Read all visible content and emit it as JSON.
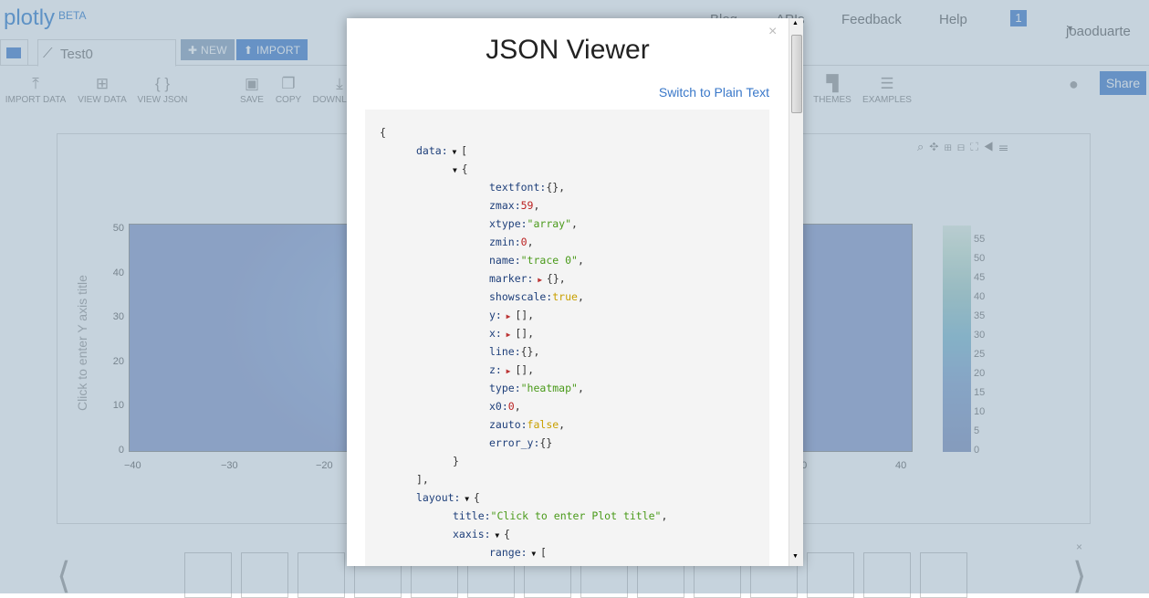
{
  "header": {
    "logo": "plotly",
    "logo_badge": "BETA",
    "nav": [
      "Blog",
      "APIs",
      "Feedback",
      "Help"
    ],
    "notification_count": "1",
    "user": "joaoduarte"
  },
  "tabs": {
    "active": "Test0",
    "new_label": "NEW",
    "import_label": "IMPORT"
  },
  "toolbar": {
    "items": [
      "IMPORT DATA",
      "VIEW DATA",
      "VIEW JSON",
      "SAVE",
      "COPY",
      "DOWNLOAD",
      "THEMES",
      "EXAMPLES"
    ],
    "share": "Share"
  },
  "plot": {
    "ytitle": "Click to enter Y axis title",
    "xticks": [
      "−40",
      "−30",
      "−20",
      "30",
      "40"
    ],
    "yticks": [
      "0",
      "10",
      "20",
      "30",
      "40",
      "50"
    ],
    "colorbar_ticks": [
      "0",
      "5",
      "10",
      "15",
      "20",
      "25",
      "30",
      "35",
      "40",
      "45",
      "50",
      "55"
    ]
  },
  "modal": {
    "title": "JSON Viewer",
    "switch_link": "Switch to Plain Text",
    "close": "×",
    "lines": [
      {
        "i": 0,
        "seg": [
          [
            "p",
            "{"
          ]
        ]
      },
      {
        "i": 1,
        "seg": [
          [
            "k",
            "data:"
          ],
          [
            "td",
            " ▼ "
          ],
          [
            "p",
            "["
          ]
        ]
      },
      {
        "i": 2,
        "seg": [
          [
            "td",
            "▼ "
          ],
          [
            "p",
            "{"
          ]
        ]
      },
      {
        "i": 3,
        "seg": [
          [
            "k",
            "textfont:"
          ],
          [
            "p",
            "{},"
          ]
        ]
      },
      {
        "i": 3,
        "seg": [
          [
            "k",
            "zmax:"
          ],
          [
            "n",
            "59"
          ],
          [
            "p",
            ","
          ]
        ]
      },
      {
        "i": 3,
        "seg": [
          [
            "k",
            "xtype:"
          ],
          [
            "s",
            "\"array\""
          ],
          [
            "p",
            ","
          ]
        ]
      },
      {
        "i": 3,
        "seg": [
          [
            "k",
            "zmin:"
          ],
          [
            "n",
            "0"
          ],
          [
            "p",
            ","
          ]
        ]
      },
      {
        "i": 3,
        "seg": [
          [
            "k",
            "name:"
          ],
          [
            "s",
            "\"trace 0\""
          ],
          [
            "p",
            ","
          ]
        ]
      },
      {
        "i": 3,
        "seg": [
          [
            "k",
            "marker:"
          ],
          [
            "tr",
            " ▶ "
          ],
          [
            "p",
            "{},"
          ]
        ]
      },
      {
        "i": 3,
        "seg": [
          [
            "k",
            "showscale:"
          ],
          [
            "b",
            "true"
          ],
          [
            "p",
            ","
          ]
        ]
      },
      {
        "i": 3,
        "seg": [
          [
            "k",
            "y:"
          ],
          [
            "tr",
            " ▶ "
          ],
          [
            "p",
            "[],"
          ]
        ]
      },
      {
        "i": 3,
        "seg": [
          [
            "k",
            "x:"
          ],
          [
            "tr",
            " ▶ "
          ],
          [
            "p",
            "[],"
          ]
        ]
      },
      {
        "i": 3,
        "seg": [
          [
            "k",
            "line:"
          ],
          [
            "p",
            "{},"
          ]
        ]
      },
      {
        "i": 3,
        "seg": [
          [
            "k",
            "z:"
          ],
          [
            "tr",
            " ▶ "
          ],
          [
            "p",
            "[],"
          ]
        ]
      },
      {
        "i": 3,
        "seg": [
          [
            "k",
            "type:"
          ],
          [
            "s",
            "\"heatmap\""
          ],
          [
            "p",
            ","
          ]
        ]
      },
      {
        "i": 3,
        "seg": [
          [
            "k",
            "x0:"
          ],
          [
            "n",
            "0"
          ],
          [
            "p",
            ","
          ]
        ]
      },
      {
        "i": 3,
        "seg": [
          [
            "k",
            "zauto:"
          ],
          [
            "b",
            "false"
          ],
          [
            "p",
            ","
          ]
        ]
      },
      {
        "i": 3,
        "seg": [
          [
            "k",
            "error_y:"
          ],
          [
            "p",
            "{}"
          ]
        ]
      },
      {
        "i": 2,
        "seg": [
          [
            "p",
            "}"
          ]
        ]
      },
      {
        "i": 1,
        "seg": [
          [
            "p",
            "],"
          ]
        ]
      },
      {
        "i": 1,
        "seg": [
          [
            "k",
            "layout:"
          ],
          [
            "td",
            " ▼ "
          ],
          [
            "p",
            "{"
          ]
        ]
      },
      {
        "i": 2,
        "seg": [
          [
            "k",
            "title:"
          ],
          [
            "s",
            "\"Click to enter Plot title\""
          ],
          [
            "p",
            ","
          ]
        ]
      },
      {
        "i": 2,
        "seg": [
          [
            "k",
            "xaxis:"
          ],
          [
            "td",
            " ▼ "
          ],
          [
            "p",
            "{"
          ]
        ]
      },
      {
        "i": 3,
        "seg": [
          [
            "k",
            "range:"
          ],
          [
            "td",
            " ▼ "
          ],
          [
            "p",
            "["
          ]
        ]
      }
    ]
  }
}
